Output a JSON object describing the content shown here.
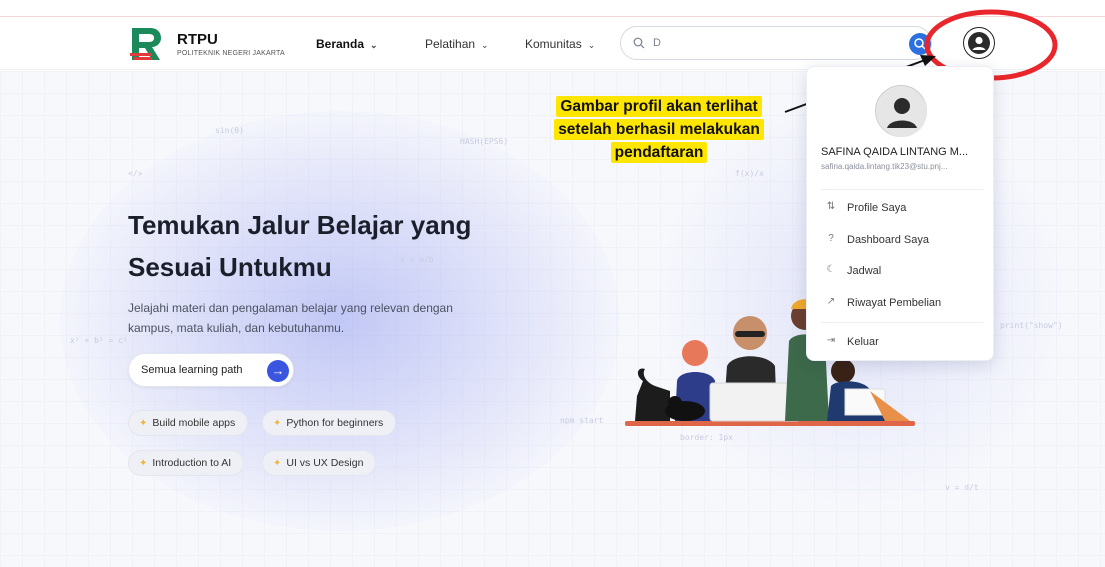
{
  "header": {
    "brand_title": "RTPU",
    "brand_subtitle": "POLITEKNIK NEGERI JAKARTA",
    "nav": [
      {
        "label": "Beranda",
        "active": true
      },
      {
        "label": "Pelatihan",
        "active": false
      },
      {
        "label": "Komunitas",
        "active": false
      }
    ],
    "search": {
      "value": "D",
      "placeholder": "Cari"
    }
  },
  "hero": {
    "title": "Temukan Jalur Belajar yang Sesuai Untukmu",
    "description": "Jelajahi materi dan pengalaman belajar yang relevan dengan kampus, mata kuliah, dan kebutuhanmu.",
    "cta_label": "Semua learning path",
    "chips": [
      "Build mobile apps",
      "Python for beginners",
      "Introduction to AI",
      "UI vs UX Design"
    ]
  },
  "profile_menu": {
    "name": "SAFINA QAIDA LINTANG M...",
    "email": "safina.qaida.lintang.tik23@stu.pnj...",
    "items": [
      {
        "label": "Profile Saya",
        "icon": "sliders-icon"
      },
      {
        "label": "Dashboard Saya",
        "icon": "question-icon"
      },
      {
        "label": "Jadwal",
        "icon": "moon-icon"
      },
      {
        "label": "Riwayat Pembelian",
        "icon": "arrow-up-right-icon"
      },
      {
        "label": "Keluar",
        "icon": "logout-icon"
      }
    ]
  },
  "annotation": {
    "lines": [
      "Gambar profil akan terlihat",
      "setelah berhasil melakukan",
      "pendaftaran"
    ],
    "highlight_color": "#ffe600",
    "circle_color": "#e8262b"
  },
  "colors": {
    "accent": "#3a55e0",
    "brand_green": "#1a8a5a",
    "brand_red": "#e03a3a"
  }
}
